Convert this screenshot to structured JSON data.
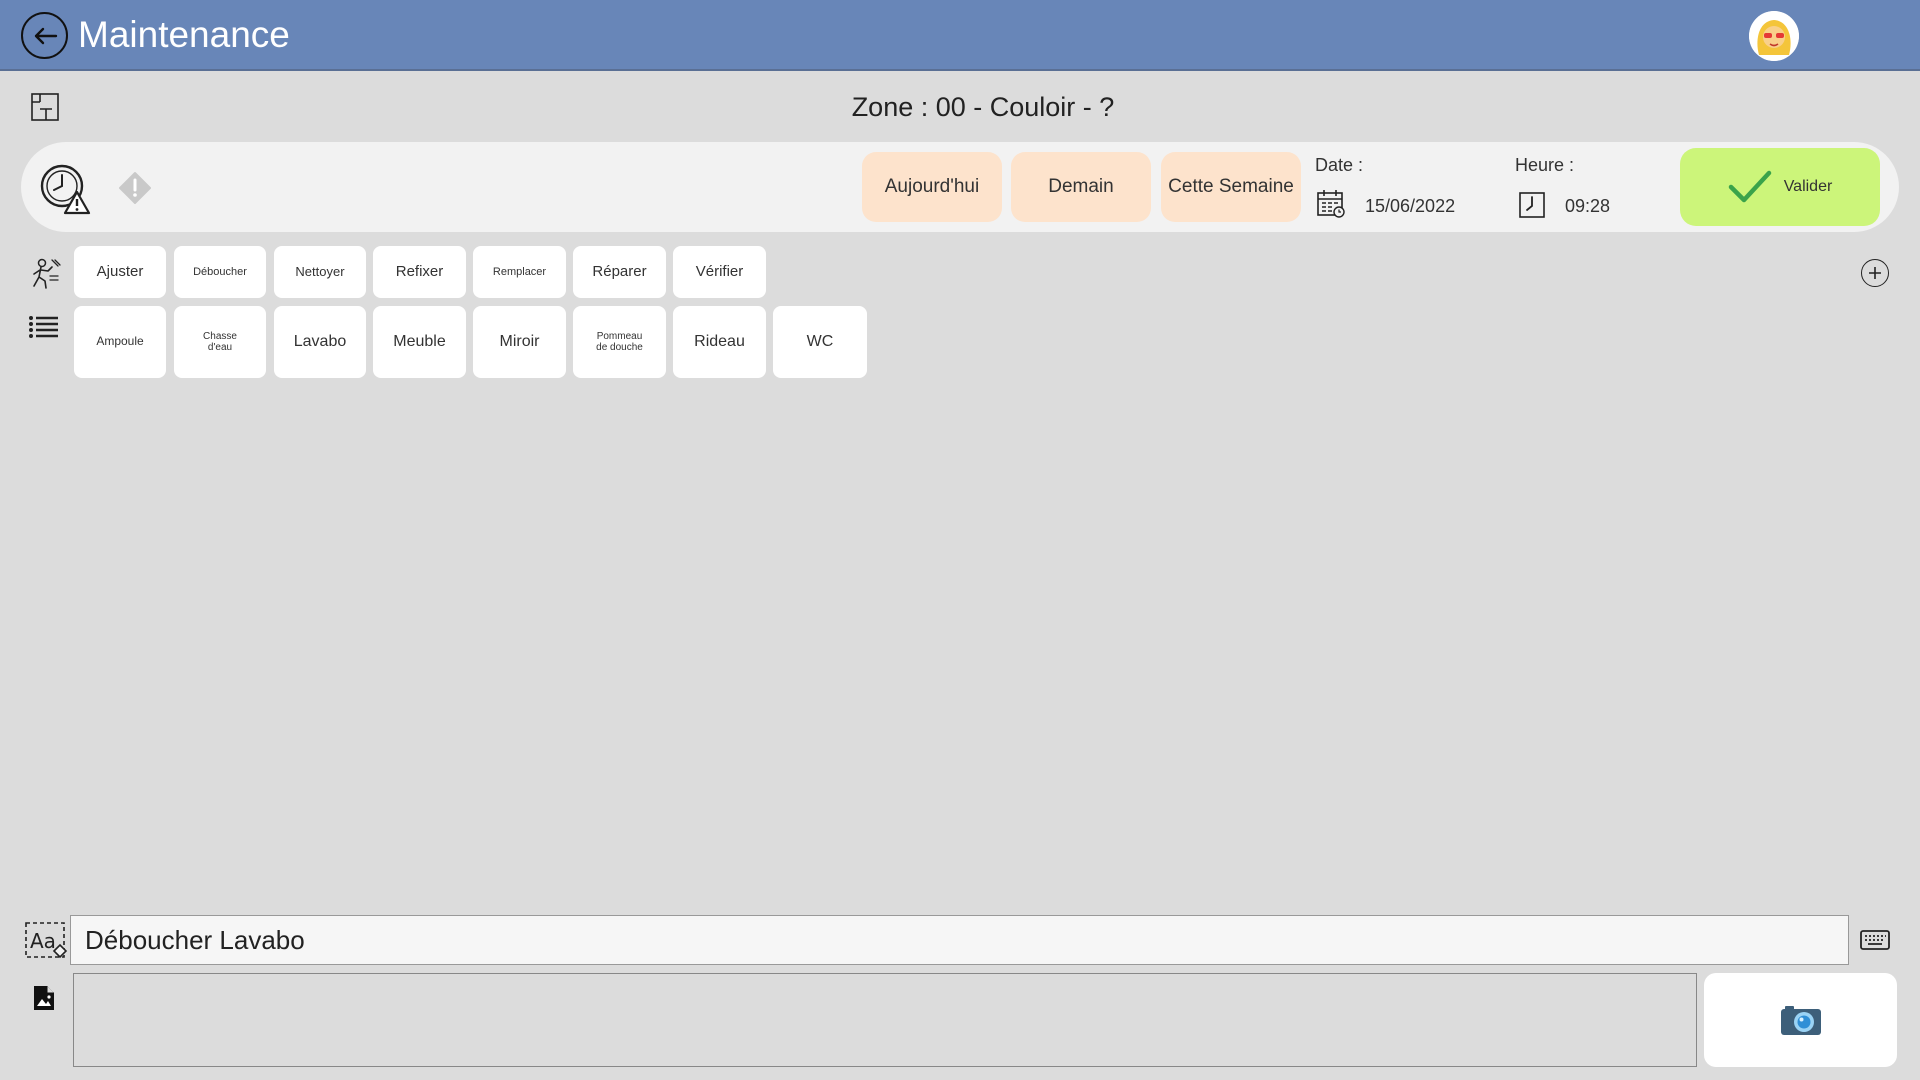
{
  "header": {
    "title": "Maintenance"
  },
  "zone": {
    "title": "Zone : 00 - Couloir - ?"
  },
  "quick_dates": [
    {
      "label": "Aujourd'hui"
    },
    {
      "label": "Demain"
    },
    {
      "label": "Cette Semaine"
    }
  ],
  "date": {
    "label": "Date :",
    "value": "15/06/2022"
  },
  "time": {
    "label": "Heure :",
    "value": "09:28"
  },
  "valider": {
    "label": "Valider"
  },
  "actions": [
    {
      "label": "Ajuster"
    },
    {
      "label": "Déboucher"
    },
    {
      "label": "Nettoyer"
    },
    {
      "label": "Refixer"
    },
    {
      "label": "Remplacer"
    },
    {
      "label": "Réparer"
    },
    {
      "label": "Vérifier"
    }
  ],
  "objects": [
    {
      "label": "Ampoule"
    },
    {
      "label": "Chasse d'eau"
    },
    {
      "label": "Lavabo"
    },
    {
      "label": "Meuble"
    },
    {
      "label": "Miroir"
    },
    {
      "label": "Pommeau de douche"
    },
    {
      "label": "Rideau"
    },
    {
      "label": "WC"
    }
  ],
  "description": {
    "value": "Déboucher Lavabo"
  },
  "icons": {
    "back": "back-arrow-icon",
    "layout": "layout-icon",
    "clock_warning": "clock-warning-icon",
    "warning": "warning-diamond-icon",
    "calendar": "calendar-icon",
    "clock": "clock-icon",
    "check": "check-icon",
    "worker": "worker-icon",
    "list": "list-icon",
    "plus": "plus-circle-icon",
    "text": "text-edit-icon",
    "keyboard": "keyboard-icon",
    "image_file": "image-file-icon",
    "camera": "camera-icon"
  },
  "colors": {
    "header": "#6886b8",
    "quick_button": "#fde3cc",
    "valider": "#ccf57a",
    "check": "#3aa34a"
  }
}
